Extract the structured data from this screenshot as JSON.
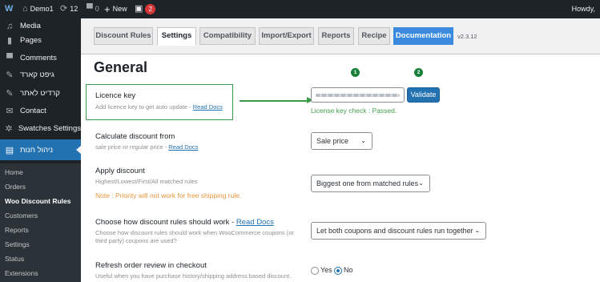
{
  "adminbar": {
    "site_name": "Demo1",
    "updates_count": "12",
    "comments_count": "0",
    "new_label": "New",
    "notification_count": "2",
    "howdy": "Howdy,",
    "icons": {
      "wp": "wordpress-icon",
      "home": "home-icon",
      "updates": "refresh-icon",
      "comments": "comment-icon",
      "new": "plus-icon",
      "plugin": "plugin-icon"
    }
  },
  "sidebar": {
    "items": [
      {
        "label": "Media",
        "icon": "media-icon"
      },
      {
        "label": "Pages",
        "icon": "pages-icon"
      },
      {
        "label": "Comments",
        "icon": "comments-icon"
      },
      {
        "label": "גיפט קארד",
        "icon": "pin-icon"
      },
      {
        "label": "קרדיט לאתר",
        "icon": "pin-icon"
      },
      {
        "label": "Contact",
        "icon": "mail-icon"
      },
      {
        "label": "Swatches Settings",
        "icon": "gear-icon"
      },
      {
        "label": "ניהול חנות",
        "icon": "store-icon"
      }
    ],
    "submenu": [
      "Home",
      "Orders",
      "Woo Discount Rules",
      "Customers",
      "Reports",
      "Settings",
      "Status",
      "Extensions"
    ],
    "current_submenu": "Woo Discount Rules"
  },
  "tabs": [
    "Discount Rules",
    "Settings",
    "Compatibility",
    "Import/Export",
    "Reports",
    "Recipe",
    "Documentation"
  ],
  "active_tab": "Settings",
  "version": "v2.3.12",
  "heading": "General",
  "steps": [
    "1",
    "2"
  ],
  "licence": {
    "label": "Licence key",
    "desc": "Add licence key to get auto update -",
    "link": "Read Docs",
    "button": "Validate",
    "status": "License key check : Passed."
  },
  "calculate": {
    "label": "Calculate discount from",
    "desc": "sale price or regular price -",
    "link": "Read Docs",
    "value": "Sale price"
  },
  "apply": {
    "label": "Apply discount",
    "desc": "Highest/Lowest/First/All matched rules",
    "note": "Note : Priority will not work for free shipping rule.",
    "value": "Biggest one from matched rules"
  },
  "coupon": {
    "label": "Choose how discount rules should work -",
    "link": "Read Docs",
    "desc1": "Choose how discount rules should work when WooCommerce coupons (or",
    "desc2": "third party) coupons are used?",
    "value": "Let both coupons and discount rules run together"
  },
  "refresh": {
    "label": "Refresh order review in checkout",
    "desc": "Useful when you have purchase history/shipping address based discount.",
    "yes": "Yes",
    "no": "No",
    "selected": "No"
  },
  "colors": {
    "accent": "#2271b1",
    "highlight": "#3a9a48",
    "pass": "#46a24c",
    "note": "#e8963a",
    "badge": "#d63638"
  }
}
